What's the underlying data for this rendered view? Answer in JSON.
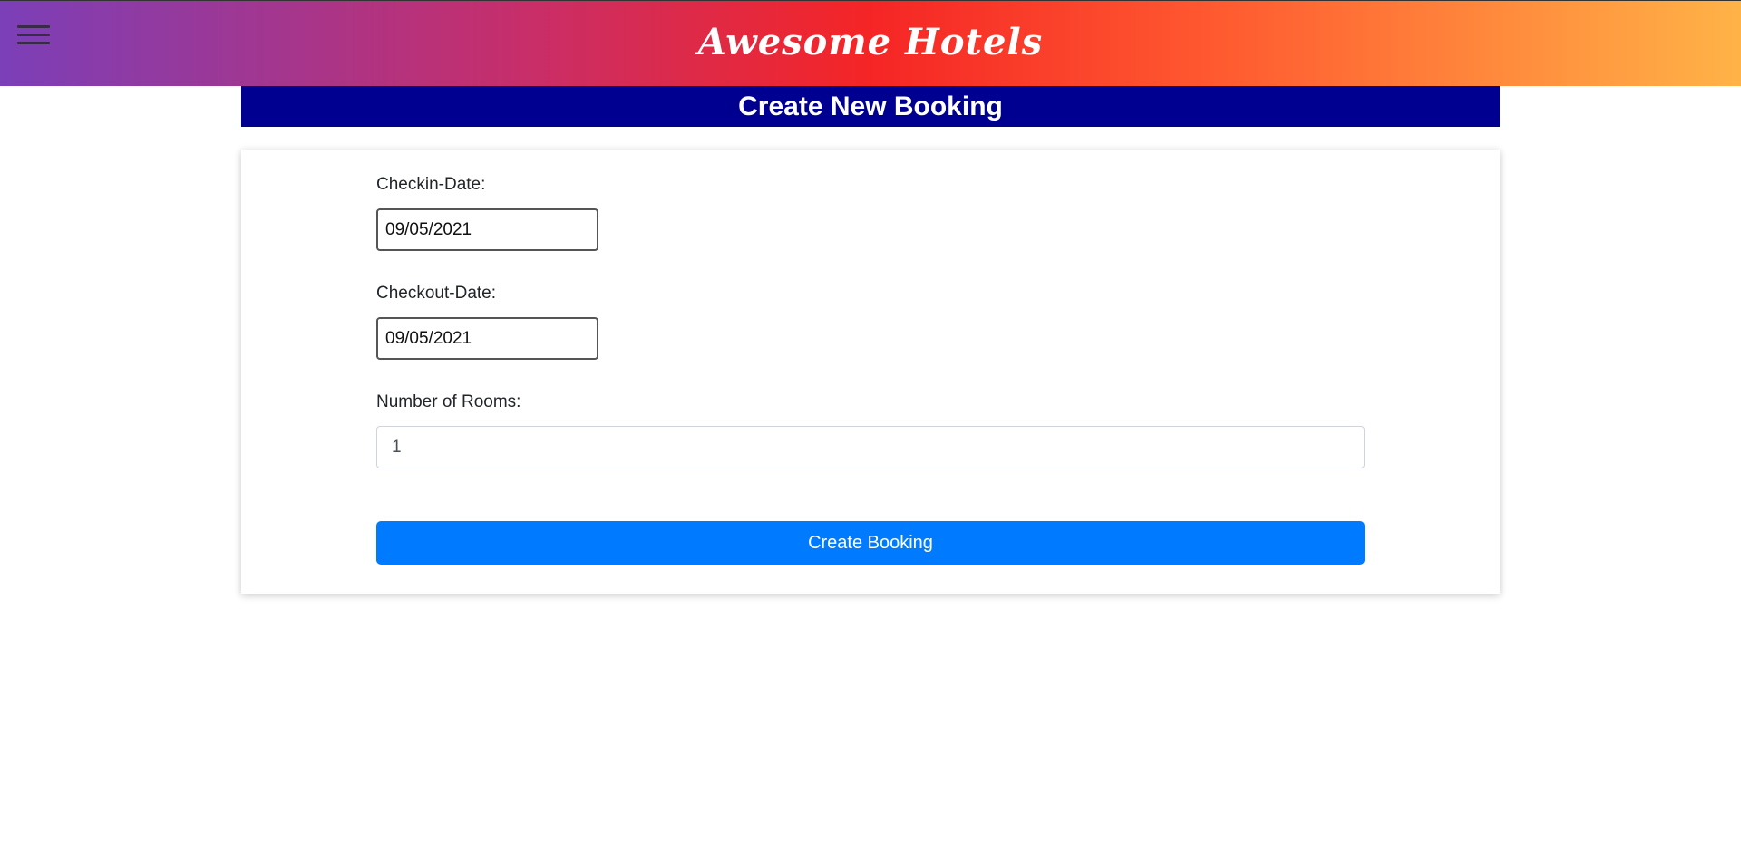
{
  "header": {
    "menu_icon": "hamburger-menu-icon",
    "title": "Awesome Hotels"
  },
  "banner": {
    "title": "Create New Booking"
  },
  "form": {
    "checkin_label": "Checkin-Date:",
    "checkin_value": "09/05/2021",
    "checkout_label": "Checkout-Date:",
    "checkout_value": "09/05/2021",
    "rooms_label": "Number of Rooms:",
    "rooms_value": "1",
    "submit_label": "Create Booking"
  },
  "colors": {
    "banner_bg": "#000090",
    "button_bg": "#007bff"
  }
}
